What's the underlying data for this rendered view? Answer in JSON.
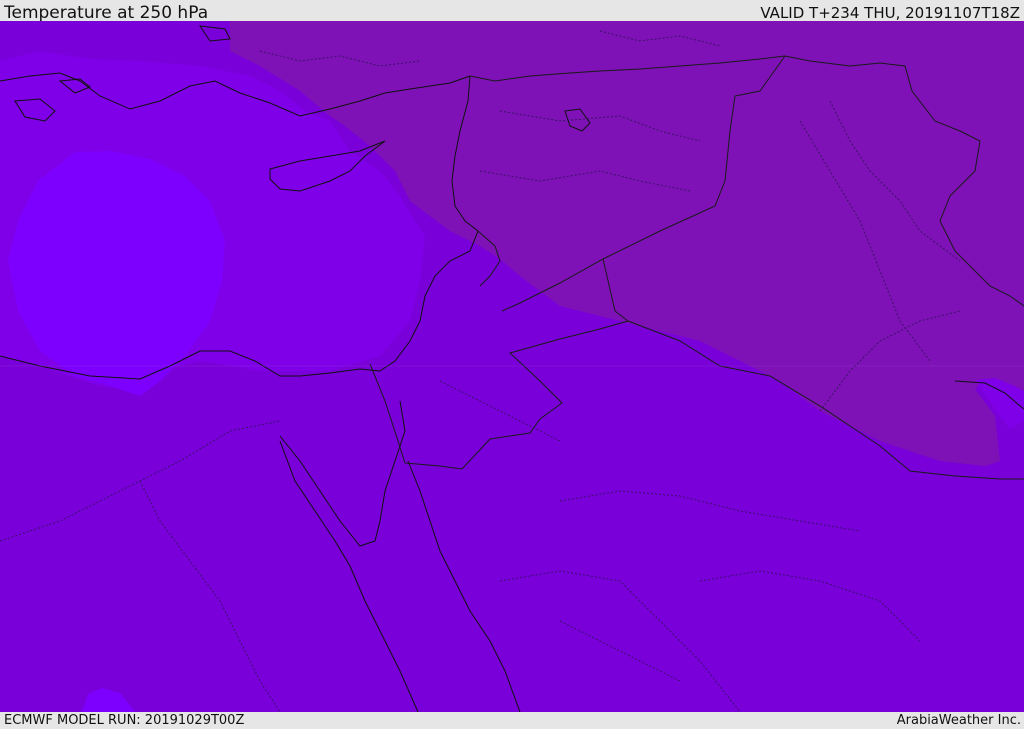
{
  "header": {
    "title": "Temperature at 250 hPa",
    "valid": "VALID T+234 THU, 20191107T18Z"
  },
  "footer": {
    "model_run": "ECMWF MODEL RUN: 20191029T00Z",
    "credit": "ArabiaWeather Inc."
  },
  "map": {
    "variable": "temperature",
    "level_hpa": 250,
    "colors": {
      "base_fill": "#7a00da",
      "warm_region_fill": "#7e12b6",
      "cold_core_fill": "#7d00ff",
      "cold_ring_fill": "#7f00e8",
      "coastline": "#111111",
      "border": "#1a1a1a",
      "admin_border": "#2a1450"
    }
  }
}
